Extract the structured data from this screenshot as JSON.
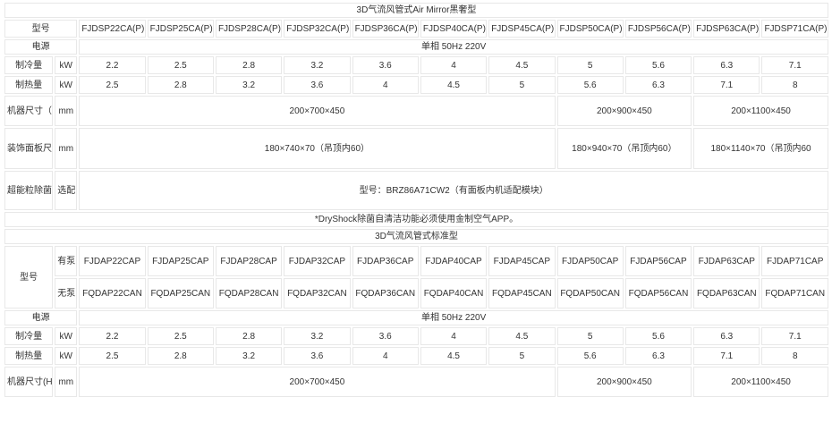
{
  "ac": {
    "title": "3D气流风管式Air Mirror黑奢型",
    "model_label": "型号",
    "models": [
      "FJDSP22CA(P)",
      "FJDSP25CA(P)",
      "FJDSP28CA(P)",
      "FJDSP32CA(P)",
      "FJDSP36CA(P)",
      "FJDSP40CA(P)",
      "FJDSP45CA(P)",
      "FJDSP50CA(P)",
      "FJDSP56CA(P)",
      "FJDSP63CA(P)",
      "FJDSP71CA(P)"
    ],
    "power_label": "电源",
    "power_value": "单相 50Hz 220V",
    "cooling_label": "制冷量",
    "cooling_unit": "kW",
    "cooling": [
      "2.2",
      "2.5",
      "2.8",
      "3.2",
      "3.6",
      "4",
      "4.5",
      "5",
      "5.6",
      "6.3",
      "7.1"
    ],
    "heating_label": "制热量",
    "heating_unit": "kW",
    "heating": [
      "2.5",
      "2.8",
      "3.2",
      "3.6",
      "4",
      "4.5",
      "5",
      "5.6",
      "6.3",
      "7.1",
      "8"
    ],
    "size_label": "机器尺寸（H×W×D）",
    "size_unit": "mm",
    "size": [
      "200×700×450",
      "200×900×450",
      "200×1100×450"
    ],
    "panel_label": "装饰面板尺寸(H×W×D）",
    "panel_unit": "mm",
    "panel": [
      "180×740×70（吊顶内60）",
      "180×940×70（吊顶内60）",
      "180×1140×70（吊顶内60"
    ],
    "filter_label": "超能粒除菌净化组件",
    "filter_unit": "选配",
    "filter_value": "型号：BRZ86A71CW2（有面板内机适配模块）",
    "note": "*DryShock除菌自清洁功能必须使用金制空气APP。"
  },
  "std": {
    "title": "3D气流风管式标准型",
    "model_label": "型号",
    "pump_label": "有泵",
    "nopump_label": "无泵",
    "models_pump": [
      "FJDAP22CAP",
      "FJDAP25CAP",
      "FJDAP28CAP",
      "FJDAP32CAP",
      "FJDAP36CAP",
      "FJDAP40CAP",
      "FJDAP45CAP",
      "FJDAP50CAP",
      "FJDAP56CAP",
      "FJDAP63CAP",
      "FJDAP71CAP"
    ],
    "models_nopump": [
      "FQDAP22CAN",
      "FQDAP25CAN",
      "FQDAP28CAN",
      "FQDAP32CAN",
      "FQDAP36CAN",
      "FQDAP40CAN",
      "FQDAP45CAN",
      "FQDAP50CAN",
      "FQDAP56CAN",
      "FQDAP63CAN",
      "FQDAP71CAN"
    ],
    "power_label": "电源",
    "power_value": "单相 50Hz 220V",
    "cooling_label": "制冷量",
    "cooling_unit": "kW",
    "cooling": [
      "2.2",
      "2.5",
      "2.8",
      "3.2",
      "3.6",
      "4",
      "4.5",
      "5",
      "5.6",
      "6.3",
      "7.1"
    ],
    "heating_label": "制热量",
    "heating_unit": "kW",
    "heating": [
      "2.5",
      "2.8",
      "3.2",
      "3.6",
      "4",
      "4.5",
      "5",
      "5.6",
      "6.3",
      "7.1",
      "8"
    ],
    "size_label": "机器尺寸(H×W×D)",
    "size_unit": "mm",
    "size": [
      "200×700×450",
      "200×900×450",
      "200×1100×450"
    ]
  }
}
